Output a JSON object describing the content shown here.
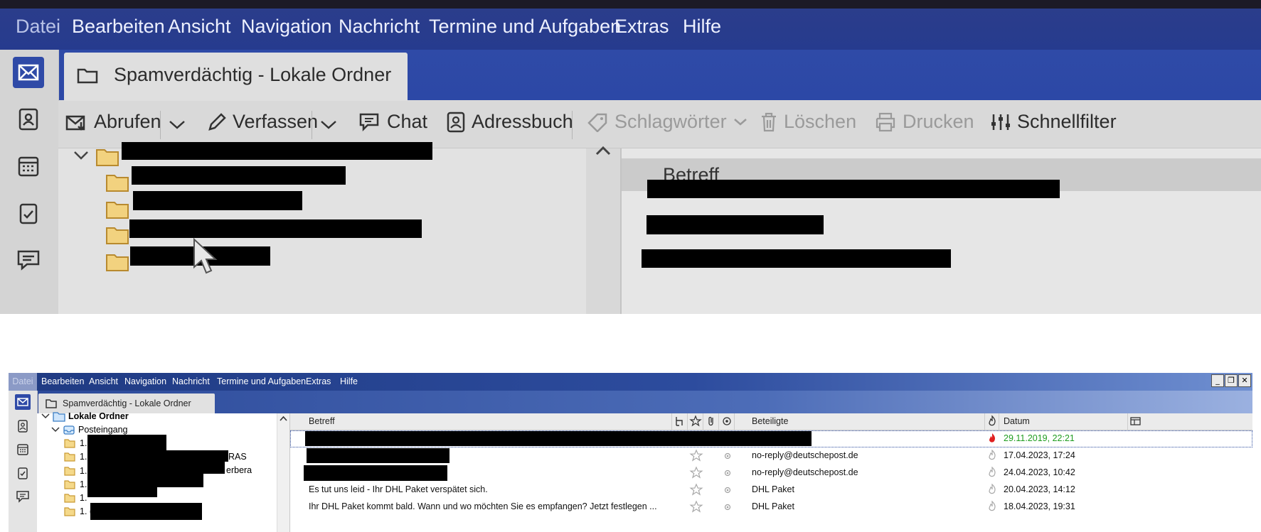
{
  "top": {
    "menu": {
      "file": "Datei",
      "edit": "Bearbeiten",
      "view": "Ansicht",
      "navigation": "Navigation",
      "message": "Nachricht",
      "tasks": "Termine und Aufgaben",
      "extras": "Extras",
      "help": "Hilfe"
    },
    "tab_title": "Spamverdächtig - Lokale Ordner",
    "toolbar": {
      "get_messages": "Abrufen",
      "compose": "Verfassen",
      "chat": "Chat",
      "address_book": "Adressbuch",
      "tags": "Schlagwörter",
      "delete": "Löschen",
      "print": "Drucken",
      "quick_filter": "Schnellfilter"
    },
    "column_subject": "Betreff"
  },
  "bottom": {
    "menu": {
      "file": "Datei",
      "edit": "Bearbeiten",
      "view": "Ansicht",
      "navigation": "Navigation",
      "message": "Nachricht",
      "tasks": "Termine und Aufgaben",
      "extras": "Extras",
      "help": "Hilfe"
    },
    "tab_title": "Spamverdächtig - Lokale Ordner",
    "folders": {
      "local": "Lokale Ordner",
      "inbox": "Posteingang",
      "sub": [
        {
          "prefix": "1.",
          "tail": ""
        },
        {
          "prefix": "1.",
          "tail": "RAS"
        },
        {
          "prefix": "1.",
          "tail": "erbera"
        },
        {
          "prefix": "1.",
          "tail": ""
        },
        {
          "prefix": "1.",
          "tail": ""
        },
        {
          "prefix": "1. (",
          "tail": ""
        }
      ]
    },
    "columns": {
      "subject": "Betreff",
      "participants": "Beteiligte",
      "date": "Datum"
    },
    "messages": [
      {
        "subject": "",
        "sender": "",
        "date": "29.11.2019, 22:21",
        "junk": true,
        "selected": true
      },
      {
        "subject": "",
        "sender": "no-reply@deutschepost.de",
        "date": "17.04.2023, 17:24",
        "junk": false
      },
      {
        "subject": "",
        "sender": "no-reply@deutschepost.de",
        "date": "24.04.2023, 10:42",
        "junk": false
      },
      {
        "subject": "Es tut uns leid - Ihr DHL Paket verspätet sich.",
        "sender": "DHL Paket",
        "date": "20.04.2023, 14:12",
        "junk": false
      },
      {
        "subject": "Ihr DHL Paket kommt bald. Wann und wo möchten Sie es empfangen? Jetzt festlegen ...",
        "sender": "DHL Paket",
        "date": "18.04.2023, 19:31",
        "junk": false
      }
    ],
    "window_buttons": {
      "minimize": "_",
      "restore": "❐",
      "close": "✕"
    }
  },
  "colors": {
    "menubar": "#263b8e",
    "accent_blue": "#2d4c9e",
    "junk_red": "#e02020",
    "date_green": "#1f9d1f"
  }
}
